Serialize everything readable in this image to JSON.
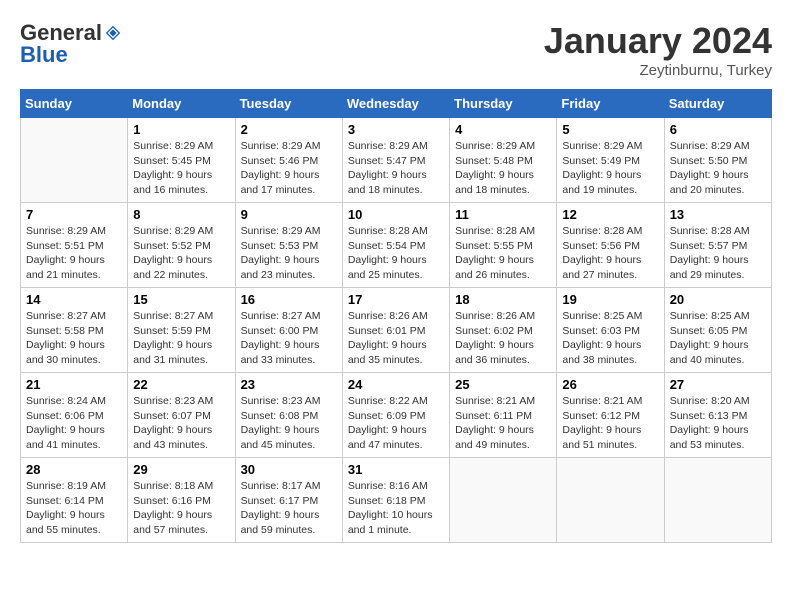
{
  "header": {
    "logo_general": "General",
    "logo_blue": "Blue",
    "month_title": "January 2024",
    "subtitle": "Zeytinburnu, Turkey"
  },
  "days_of_week": [
    "Sunday",
    "Monday",
    "Tuesday",
    "Wednesday",
    "Thursday",
    "Friday",
    "Saturday"
  ],
  "weeks": [
    [
      {
        "day": "",
        "info": ""
      },
      {
        "day": "1",
        "info": "Sunrise: 8:29 AM\nSunset: 5:45 PM\nDaylight: 9 hours\nand 16 minutes."
      },
      {
        "day": "2",
        "info": "Sunrise: 8:29 AM\nSunset: 5:46 PM\nDaylight: 9 hours\nand 17 minutes."
      },
      {
        "day": "3",
        "info": "Sunrise: 8:29 AM\nSunset: 5:47 PM\nDaylight: 9 hours\nand 18 minutes."
      },
      {
        "day": "4",
        "info": "Sunrise: 8:29 AM\nSunset: 5:48 PM\nDaylight: 9 hours\nand 18 minutes."
      },
      {
        "day": "5",
        "info": "Sunrise: 8:29 AM\nSunset: 5:49 PM\nDaylight: 9 hours\nand 19 minutes."
      },
      {
        "day": "6",
        "info": "Sunrise: 8:29 AM\nSunset: 5:50 PM\nDaylight: 9 hours\nand 20 minutes."
      }
    ],
    [
      {
        "day": "7",
        "info": "Sunrise: 8:29 AM\nSunset: 5:51 PM\nDaylight: 9 hours\nand 21 minutes."
      },
      {
        "day": "8",
        "info": "Sunrise: 8:29 AM\nSunset: 5:52 PM\nDaylight: 9 hours\nand 22 minutes."
      },
      {
        "day": "9",
        "info": "Sunrise: 8:29 AM\nSunset: 5:53 PM\nDaylight: 9 hours\nand 23 minutes."
      },
      {
        "day": "10",
        "info": "Sunrise: 8:28 AM\nSunset: 5:54 PM\nDaylight: 9 hours\nand 25 minutes."
      },
      {
        "day": "11",
        "info": "Sunrise: 8:28 AM\nSunset: 5:55 PM\nDaylight: 9 hours\nand 26 minutes."
      },
      {
        "day": "12",
        "info": "Sunrise: 8:28 AM\nSunset: 5:56 PM\nDaylight: 9 hours\nand 27 minutes."
      },
      {
        "day": "13",
        "info": "Sunrise: 8:28 AM\nSunset: 5:57 PM\nDaylight: 9 hours\nand 29 minutes."
      }
    ],
    [
      {
        "day": "14",
        "info": "Sunrise: 8:27 AM\nSunset: 5:58 PM\nDaylight: 9 hours\nand 30 minutes."
      },
      {
        "day": "15",
        "info": "Sunrise: 8:27 AM\nSunset: 5:59 PM\nDaylight: 9 hours\nand 31 minutes."
      },
      {
        "day": "16",
        "info": "Sunrise: 8:27 AM\nSunset: 6:00 PM\nDaylight: 9 hours\nand 33 minutes."
      },
      {
        "day": "17",
        "info": "Sunrise: 8:26 AM\nSunset: 6:01 PM\nDaylight: 9 hours\nand 35 minutes."
      },
      {
        "day": "18",
        "info": "Sunrise: 8:26 AM\nSunset: 6:02 PM\nDaylight: 9 hours\nand 36 minutes."
      },
      {
        "day": "19",
        "info": "Sunrise: 8:25 AM\nSunset: 6:03 PM\nDaylight: 9 hours\nand 38 minutes."
      },
      {
        "day": "20",
        "info": "Sunrise: 8:25 AM\nSunset: 6:05 PM\nDaylight: 9 hours\nand 40 minutes."
      }
    ],
    [
      {
        "day": "21",
        "info": "Sunrise: 8:24 AM\nSunset: 6:06 PM\nDaylight: 9 hours\nand 41 minutes."
      },
      {
        "day": "22",
        "info": "Sunrise: 8:23 AM\nSunset: 6:07 PM\nDaylight: 9 hours\nand 43 minutes."
      },
      {
        "day": "23",
        "info": "Sunrise: 8:23 AM\nSunset: 6:08 PM\nDaylight: 9 hours\nand 45 minutes."
      },
      {
        "day": "24",
        "info": "Sunrise: 8:22 AM\nSunset: 6:09 PM\nDaylight: 9 hours\nand 47 minutes."
      },
      {
        "day": "25",
        "info": "Sunrise: 8:21 AM\nSunset: 6:11 PM\nDaylight: 9 hours\nand 49 minutes."
      },
      {
        "day": "26",
        "info": "Sunrise: 8:21 AM\nSunset: 6:12 PM\nDaylight: 9 hours\nand 51 minutes."
      },
      {
        "day": "27",
        "info": "Sunrise: 8:20 AM\nSunset: 6:13 PM\nDaylight: 9 hours\nand 53 minutes."
      }
    ],
    [
      {
        "day": "28",
        "info": "Sunrise: 8:19 AM\nSunset: 6:14 PM\nDaylight: 9 hours\nand 55 minutes."
      },
      {
        "day": "29",
        "info": "Sunrise: 8:18 AM\nSunset: 6:16 PM\nDaylight: 9 hours\nand 57 minutes."
      },
      {
        "day": "30",
        "info": "Sunrise: 8:17 AM\nSunset: 6:17 PM\nDaylight: 9 hours\nand 59 minutes."
      },
      {
        "day": "31",
        "info": "Sunrise: 8:16 AM\nSunset: 6:18 PM\nDaylight: 10 hours\nand 1 minute."
      },
      {
        "day": "",
        "info": ""
      },
      {
        "day": "",
        "info": ""
      },
      {
        "day": "",
        "info": ""
      }
    ]
  ]
}
